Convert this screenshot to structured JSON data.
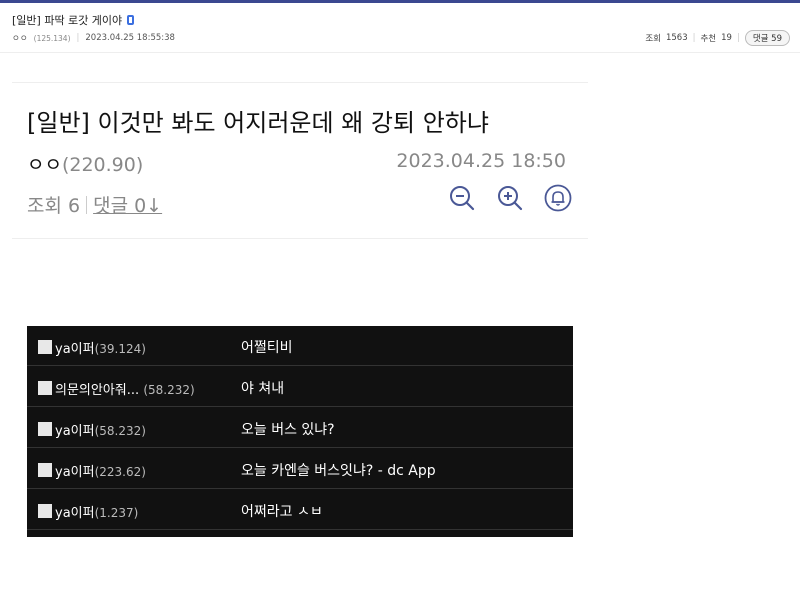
{
  "post": {
    "title": "[일반] 파딱 로갓 게이야",
    "author": "ㅇㅇ",
    "author_ip": "(125.134)",
    "date": "2023.04.25 18:55:38",
    "views_label": "조회",
    "views": "1563",
    "recommend_label": "추천",
    "recommend": "19",
    "comments_label": "댓글",
    "comments_count": "59"
  },
  "embedded": {
    "title": "[일반] 이것만 봐도 어지러운데 왜 강퇴 안하냐",
    "author": "ㅇㅇ",
    "author_ip": "(220.90)",
    "date": "2023.04.25 18:50",
    "views_text": "조회 6",
    "comments_text": "댓글 0↓",
    "icons": [
      "zoom-out-icon",
      "zoom-in-icon",
      "bell-icon"
    ]
  },
  "comments": [
    {
      "name": "ya이퍼",
      "ip": "(39.124)",
      "text": "어쩔티비"
    },
    {
      "name": "의문의안아줘...",
      "ip": "(58.232)",
      "text": "야 쳐내"
    },
    {
      "name": "ya이퍼",
      "ip": "(58.232)",
      "text": "오늘 버스 있냐?"
    },
    {
      "name": "ya이퍼",
      "ip": "(223.62)",
      "text": "오늘 카엔슬 버스잇냐? - dc App"
    },
    {
      "name": "ya이퍼",
      "ip": "(1.237)",
      "text": "어쩌라고 ㅅㅂ"
    }
  ],
  "colors": {
    "accent": "#3b4890",
    "mobile_icon": "#3b6fe0",
    "comment_bg": "#111111"
  }
}
